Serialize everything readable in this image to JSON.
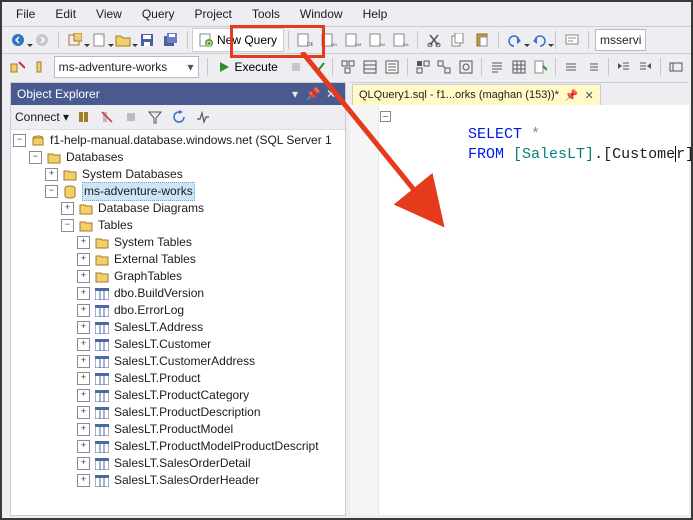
{
  "menu": [
    "File",
    "Edit",
    "View",
    "Query",
    "Project",
    "Tools",
    "Window",
    "Help"
  ],
  "toolbar1": {
    "new_query_label": "New Query",
    "conn_box": "msservi"
  },
  "toolbar2": {
    "db_selected": "ms-adventure-works",
    "execute_label": "Execute"
  },
  "object_explorer": {
    "title": "Object Explorer",
    "connect_label": "Connect",
    "root": "f1-help-manual.database.windows.net (SQL Server 1",
    "databases": "Databases",
    "sysdb": "System Databases",
    "userdb": "ms-adventure-works",
    "dbchildren": {
      "diagrams": "Database Diagrams",
      "tables": "Tables",
      "sys_tables": "System Tables",
      "ext_tables": "External Tables",
      "graph_tables": "GraphTables",
      "t0": "dbo.BuildVersion",
      "t1": "dbo.ErrorLog",
      "t2": "SalesLT.Address",
      "t3": "SalesLT.Customer",
      "t4": "SalesLT.CustomerAddress",
      "t5": "SalesLT.Product",
      "t6": "SalesLT.ProductCategory",
      "t7": "SalesLT.ProductDescription",
      "t8": "SalesLT.ProductModel",
      "t9": "SalesLT.ProductModelProductDescript",
      "t10": "SalesLT.SalesOrderDetail",
      "t11": "SalesLT.SalesOrderHeader"
    }
  },
  "editor": {
    "tab_label": "QLQuery1.sql - f1...orks (maghan (153))*",
    "line1_kw": "SELECT",
    "line1_rest": " *",
    "line2_kw": "FROM",
    "line2_schema": "[SalesLT]",
    "line2_dot": ".",
    "line2_obj_a": "[Custome",
    "line2_obj_b": "r]"
  }
}
